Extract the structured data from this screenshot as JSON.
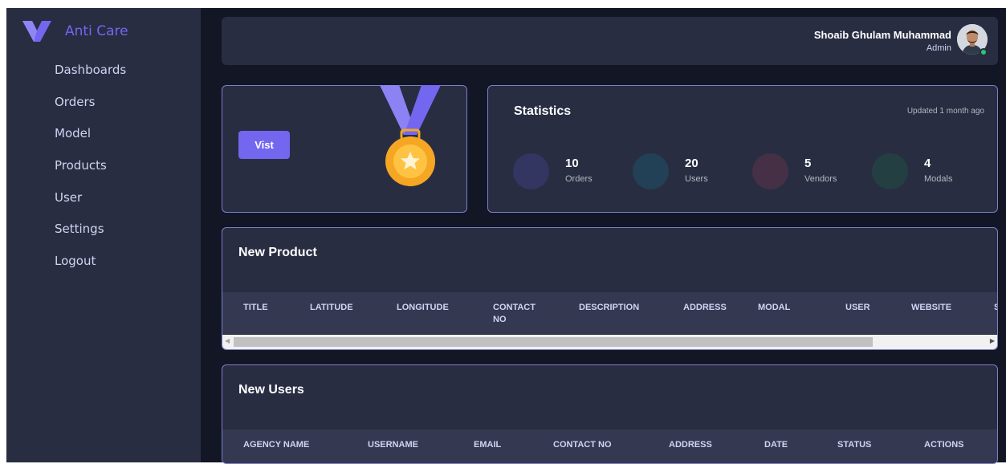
{
  "brand": {
    "name": "Anti Care",
    "logo_icon": "v-logo-icon",
    "accent": "#7367f0"
  },
  "sidebar": {
    "items": [
      {
        "label": "Dashboards"
      },
      {
        "label": "Orders"
      },
      {
        "label": "Model"
      },
      {
        "label": "Products"
      },
      {
        "label": "User"
      },
      {
        "label": "Settings"
      },
      {
        "label": "Logout"
      }
    ]
  },
  "topbar": {
    "user_name": "Shoaib Ghulam Muhammad",
    "user_role": "Admin",
    "status_color": "#28c76f"
  },
  "medal_card": {
    "button_label": "Vist",
    "icon": "medal-icon"
  },
  "statistics": {
    "title": "Statistics",
    "updated": "Updated 1 month ago",
    "items": [
      {
        "value": "10",
        "label": "Orders",
        "color": "#333661"
      },
      {
        "value": "20",
        "label": "Users",
        "color": "#224056"
      },
      {
        "value": "5",
        "label": "Vendors",
        "color": "#463045"
      },
      {
        "value": "4",
        "label": "Modals",
        "color": "#233f42"
      }
    ]
  },
  "new_product": {
    "title": "New Product",
    "columns": [
      "TITLE",
      "LATITUDE",
      "LONGITUDE",
      "CONTACT NO",
      "DESCRIPTION",
      "ADDRESS",
      "MODAL",
      "USER",
      "WEBSITE",
      "S"
    ]
  },
  "new_users": {
    "title": "New Users",
    "columns": [
      "AGENCY NAME",
      "USERNAME",
      "EMAIL",
      "CONTACT NO",
      "ADDRESS",
      "DATE",
      "STATUS",
      "ACTIONS"
    ]
  }
}
